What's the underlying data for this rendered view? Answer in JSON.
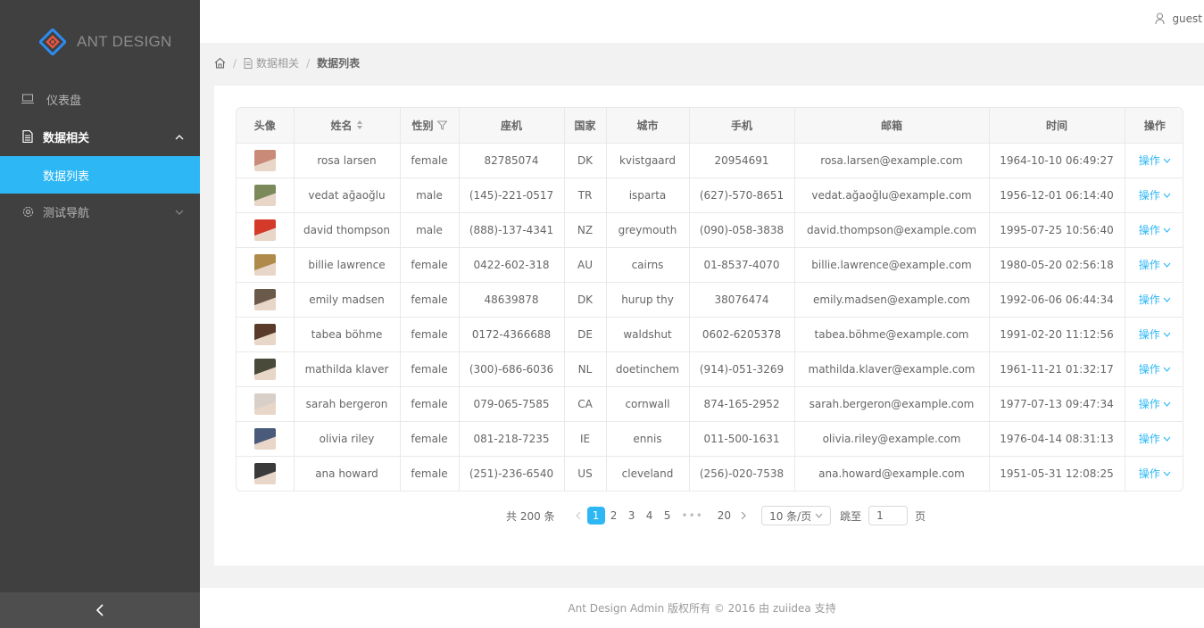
{
  "logo": {
    "text": "ANT DESIGN"
  },
  "sidebar": {
    "items": [
      {
        "label": "仪表盘",
        "icon": "laptop-icon"
      },
      {
        "label": "数据相关",
        "icon": "file-icon"
      },
      {
        "label": "数据列表"
      },
      {
        "label": "测试导航",
        "icon": "setting-icon"
      }
    ]
  },
  "header": {
    "user": "guest"
  },
  "breadcrumb": {
    "items": [
      "数据相关",
      "数据列表"
    ]
  },
  "table": {
    "columns": [
      "头像",
      "姓名",
      "性别",
      "座机",
      "国家",
      "城市",
      "手机",
      "邮箱",
      "时间",
      "操作"
    ],
    "action_label": "操作",
    "rows": [
      {
        "name": "rosa larsen",
        "gender": "female",
        "phone": "82785074",
        "nat": "DK",
        "city": "kvistgaard",
        "cell": "20954691",
        "email": "rosa.larsen@example.com",
        "time": "1964-10-10 06:49:27",
        "avatar_color": "#c98a78"
      },
      {
        "name": "vedat ağaoğlu",
        "gender": "male",
        "phone": "(145)-221-0517",
        "nat": "TR",
        "city": "isparta",
        "cell": "(627)-570-8651",
        "email": "vedat.ağaoğlu@example.com",
        "time": "1956-12-01 06:14:40",
        "avatar_color": "#7a8a5a"
      },
      {
        "name": "david thompson",
        "gender": "male",
        "phone": "(888)-137-4341",
        "nat": "NZ",
        "city": "greymouth",
        "cell": "(090)-058-3838",
        "email": "david.thompson@example.com",
        "time": "1995-07-25 10:56:40",
        "avatar_color": "#d43a2a"
      },
      {
        "name": "billie lawrence",
        "gender": "female",
        "phone": "0422-602-318",
        "nat": "AU",
        "city": "cairns",
        "cell": "01-8537-4070",
        "email": "billie.lawrence@example.com",
        "time": "1980-05-20 02:56:18",
        "avatar_color": "#b08a4a"
      },
      {
        "name": "emily madsen",
        "gender": "female",
        "phone": "48639878",
        "nat": "DK",
        "city": "hurup thy",
        "cell": "38076474",
        "email": "emily.madsen@example.com",
        "time": "1992-06-06 06:44:34",
        "avatar_color": "#6a5a4a"
      },
      {
        "name": "tabea böhme",
        "gender": "female",
        "phone": "0172-4366688",
        "nat": "DE",
        "city": "waldshut",
        "cell": "0602-6205378",
        "email": "tabea.böhme@example.com",
        "time": "1991-02-20 11:12:56",
        "avatar_color": "#5a3a2a"
      },
      {
        "name": "mathilda klaver",
        "gender": "female",
        "phone": "(300)-686-6036",
        "nat": "NL",
        "city": "doetinchem",
        "cell": "(914)-051-3269",
        "email": "mathilda.klaver@example.com",
        "time": "1961-11-21 01:32:17",
        "avatar_color": "#4a4a3a"
      },
      {
        "name": "sarah bergeron",
        "gender": "female",
        "phone": "079-065-7585",
        "nat": "CA",
        "city": "cornwall",
        "cell": "874-165-2952",
        "email": "sarah.bergeron@example.com",
        "time": "1977-07-13 09:47:34",
        "avatar_color": "#d8d0c8"
      },
      {
        "name": "olivia riley",
        "gender": "female",
        "phone": "081-218-7235",
        "nat": "IE",
        "city": "ennis",
        "cell": "011-500-1631",
        "email": "olivia.riley@example.com",
        "time": "1976-04-14 08:31:13",
        "avatar_color": "#4a5a7a"
      },
      {
        "name": "ana howard",
        "gender": "female",
        "phone": "(251)-236-6540",
        "nat": "US",
        "city": "cleveland",
        "cell": "(256)-020-7538",
        "email": "ana.howard@example.com",
        "time": "1951-05-31 12:08:25",
        "avatar_color": "#3a3a3a"
      }
    ]
  },
  "pagination": {
    "total_label": "共 200 条",
    "pages": [
      "1",
      "2",
      "3",
      "4",
      "5"
    ],
    "ellipsis": "•••",
    "last_page": "20",
    "current": "1",
    "page_size": "10 条/页",
    "jump_label": "跳至",
    "jump_value": "1",
    "page_unit": "页"
  },
  "footer": {
    "text": "Ant Design Admin 版权所有 © 2016 由 zuiidea 支持"
  },
  "colors": {
    "accent": "#2db7f5",
    "sidebar_bg": "#404040",
    "logo_red": "#e8543f",
    "logo_blue": "#2d8cf0"
  }
}
